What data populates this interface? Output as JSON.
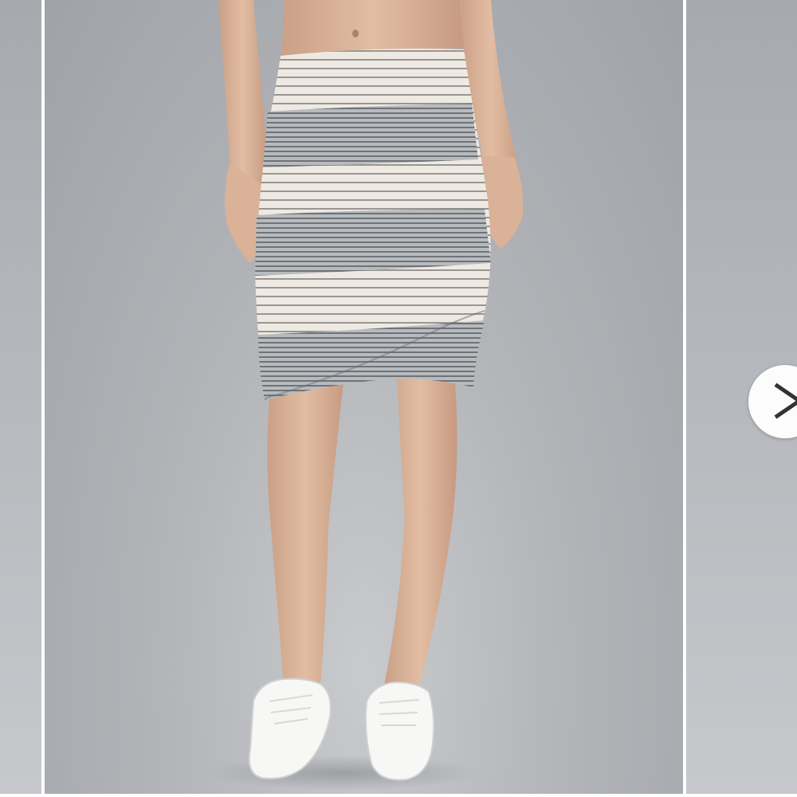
{
  "gallery": {
    "current_photo_icon": "product-photo",
    "next_icon": "chevron-right-icon"
  },
  "colors": {
    "background": "#ffffff",
    "backdrop": "#b2b4b8",
    "skirt_light": "#efe9e3",
    "skirt_gray": "#9ea2a6",
    "arrow_button": "#ffffff",
    "arrow_glyph": "#333333"
  }
}
